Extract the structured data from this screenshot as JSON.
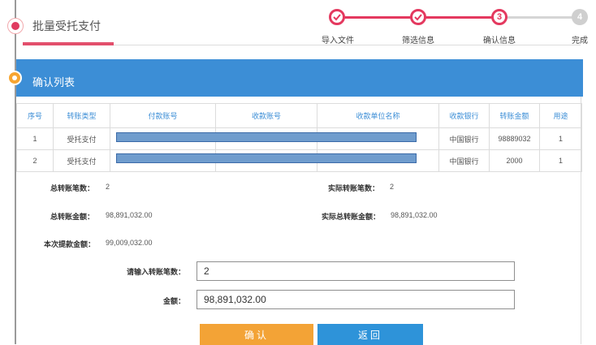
{
  "page": {
    "title": "批量受托支付"
  },
  "steps": [
    {
      "number": "1",
      "label": "导入文件",
      "state": "done"
    },
    {
      "number": "2",
      "label": "筛选信息",
      "state": "done"
    },
    {
      "number": "3",
      "label": "确认信息",
      "state": "current"
    },
    {
      "number": "4",
      "label": "完成",
      "state": "todo"
    }
  ],
  "section": {
    "title": "确认列表"
  },
  "table": {
    "headers": [
      "序号",
      "转账类型",
      "付款账号",
      "收款账号",
      "收款单位名称",
      "收款银行",
      "转账金额",
      "用途"
    ],
    "rows": [
      {
        "no": "1",
        "type": "受托支付",
        "payer": "",
        "payee": "",
        "payee_name": "",
        "bank": "中国银行",
        "amount": "98889032",
        "purpose": "1"
      },
      {
        "no": "2",
        "type": "受托支付",
        "payer": "",
        "payee": "",
        "payee_name": "",
        "bank": "中国银行",
        "amount": "2000",
        "purpose": "1"
      }
    ]
  },
  "summary": {
    "total_count_label": "总转账笔数：",
    "total_count": "2",
    "actual_count_label": "实际转账笔数：",
    "actual_count": "2",
    "total_amount_label": "总转账金额：",
    "total_amount": "98,891,032.00",
    "actual_amount_label": "实际总转账金额：",
    "actual_amount": "98,891,032.00",
    "withdraw_label": "本次提款金额：",
    "withdraw_amount": "99,009,032.00"
  },
  "form": {
    "count_label": "请输入转账笔数：",
    "count_value": "2",
    "amount_label": "金额：",
    "amount_value": "98,891,032.00"
  },
  "buttons": {
    "confirm": "确认",
    "back": "返回"
  },
  "colors": {
    "accent_red": "#e4395f",
    "header_blue": "#3c8ed6",
    "confirm_orange": "#f3a336",
    "back_blue": "#2e93d9"
  }
}
